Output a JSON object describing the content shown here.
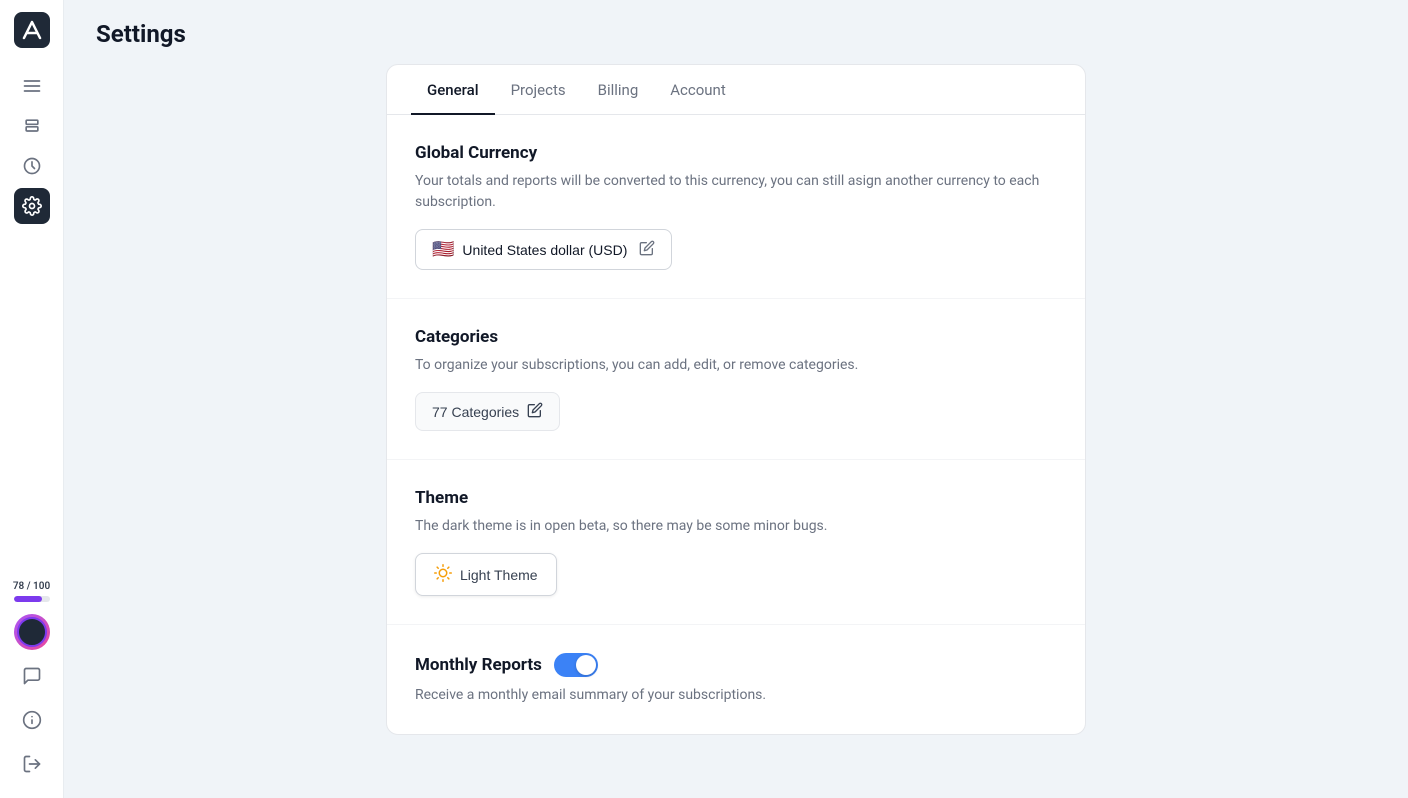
{
  "app": {
    "title": "Settings"
  },
  "sidebar": {
    "logo_alt": "App logo",
    "icons": [
      {
        "name": "menu-icon",
        "label": "Menu",
        "interactable": true,
        "active": false
      },
      {
        "name": "layers-icon",
        "label": "Layers",
        "interactable": true,
        "active": false
      },
      {
        "name": "clock-icon",
        "label": "History",
        "interactable": true,
        "active": false
      },
      {
        "name": "settings-icon",
        "label": "Settings",
        "interactable": true,
        "active": true
      }
    ],
    "usage": {
      "text": "78 / 100",
      "fill_percent": 78
    }
  },
  "tabs": [
    {
      "label": "General",
      "active": true
    },
    {
      "label": "Projects",
      "active": false
    },
    {
      "label": "Billing",
      "active": false
    },
    {
      "label": "Account",
      "active": false
    }
  ],
  "sections": {
    "currency": {
      "title": "Global Currency",
      "description": "Your totals and reports will be converted to this currency, you can still asign another currency to each subscription.",
      "button_label": "United States dollar (USD)",
      "flag": "🇺🇸"
    },
    "categories": {
      "title": "Categories",
      "description": "To organize your subscriptions, you can add, edit, or remove categories.",
      "button_label": "77 Categories"
    },
    "theme": {
      "title": "Theme",
      "description": "The dark theme is in open beta, so there may be some minor bugs.",
      "button_label": "Light Theme"
    },
    "monthly_reports": {
      "title": "Monthly Reports",
      "description": "Receive a monthly email summary of your subscriptions.",
      "toggle_enabled": true
    }
  }
}
